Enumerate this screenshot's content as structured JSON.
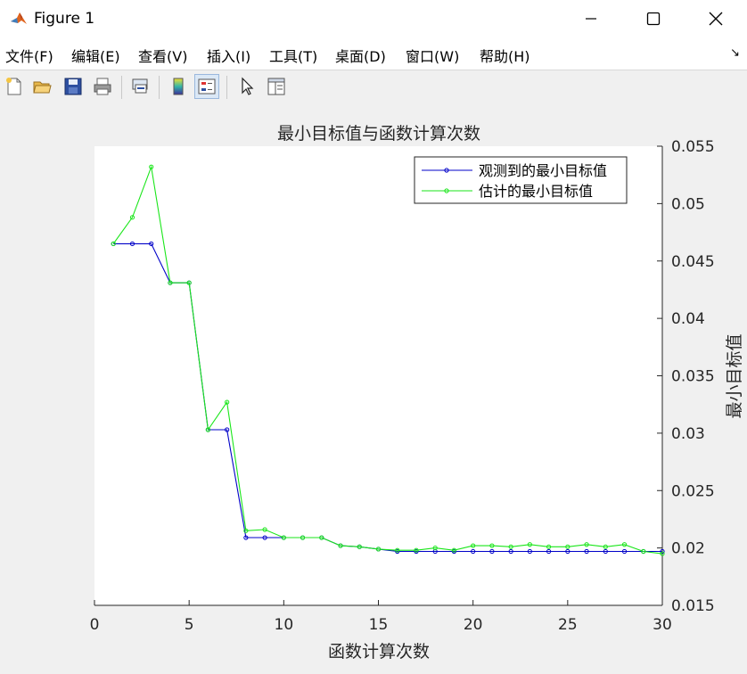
{
  "window": {
    "title": "Figure 1",
    "controls": [
      "minimize",
      "maximize",
      "close"
    ]
  },
  "menu": [
    "文件(F)",
    "编辑(E)",
    "查看(V)",
    "插入(I)",
    "工具(T)",
    "桌面(D)",
    "窗口(W)",
    "帮助(H)"
  ],
  "toolbar": [
    "new-figure-icon",
    "open-file-icon",
    "save-icon",
    "print-icon",
    "link-plot-icon",
    "colorbar-icon",
    "legend-icon",
    "pointer-icon",
    "property-editor-icon"
  ],
  "chart_data": {
    "type": "line",
    "title": "最小目标值与函数计算次数",
    "xlabel": "函数计算次数",
    "ylabel": "最小目标值",
    "xlim": [
      0,
      30
    ],
    "ylim": [
      0.015,
      0.055
    ],
    "xticks": [
      "0",
      "5",
      "10",
      "15",
      "20",
      "25",
      "30"
    ],
    "yticks": [
      "0.015",
      "0.02",
      "0.025",
      "0.03",
      "0.035",
      "0.04",
      "0.045",
      "0.05",
      "0.055"
    ],
    "y_axis_location": "right",
    "grid": false,
    "legend_position": "top-right",
    "series": [
      {
        "name": "观测到的最小目标值",
        "color": "#0000c8",
        "x": [
          1,
          2,
          3,
          4,
          5,
          6,
          7,
          8,
          9,
          10,
          11,
          12,
          13,
          14,
          15,
          16,
          17,
          18,
          19,
          20,
          21,
          22,
          23,
          24,
          25,
          26,
          27,
          28,
          29,
          30
        ],
        "y": [
          0.0465,
          0.0465,
          0.0465,
          0.0431,
          0.0431,
          0.0303,
          0.0303,
          0.0209,
          0.0209,
          0.0209,
          0.0209,
          0.0209,
          0.0202,
          0.0201,
          0.0199,
          0.0197,
          0.0197,
          0.0197,
          0.0197,
          0.0197,
          0.0197,
          0.0197,
          0.0197,
          0.0197,
          0.0197,
          0.0197,
          0.0197,
          0.0197,
          0.0197,
          0.0197
        ]
      },
      {
        "name": "估计的最小目标值",
        "color": "#19e619",
        "x": [
          1,
          2,
          3,
          4,
          5,
          6,
          7,
          8,
          9,
          10,
          11,
          12,
          13,
          14,
          15,
          16,
          17,
          18,
          19,
          20,
          21,
          22,
          23,
          24,
          25,
          26,
          27,
          28,
          29,
          30
        ],
        "y": [
          0.0465,
          0.0488,
          0.0532,
          0.0431,
          0.0431,
          0.0303,
          0.0327,
          0.0215,
          0.0216,
          0.0209,
          0.0209,
          0.0209,
          0.0202,
          0.0201,
          0.0199,
          0.0198,
          0.0198,
          0.02,
          0.0198,
          0.0202,
          0.0202,
          0.0201,
          0.0203,
          0.0201,
          0.0201,
          0.0203,
          0.0201,
          0.0203,
          0.0197,
          0.0195
        ]
      }
    ]
  }
}
